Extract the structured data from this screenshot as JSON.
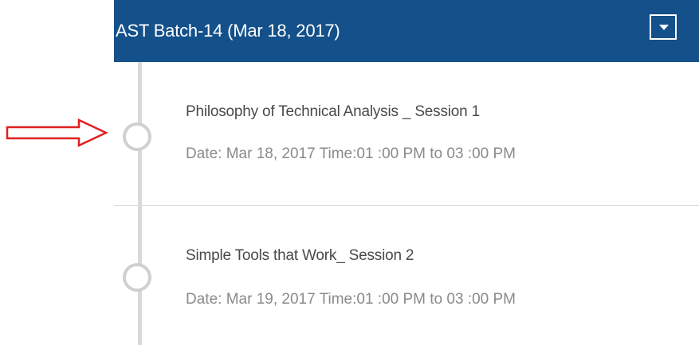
{
  "header": {
    "title": "AST Batch-14 (Mar 18, 2017)",
    "dropdown_icon": "caret-down-icon",
    "background_color": "#14508a"
  },
  "sessions": [
    {
      "title": "Philosophy of Technical Analysis _ Session 1",
      "datetime": "Date: Mar 18, 2017 Time:01 :00 PM to 03 :00 PM"
    },
    {
      "title": "Simple Tools that Work_ Session 2",
      "datetime": "Date: Mar 19, 2017 Time:01 :00 PM to 03 :00 PM"
    }
  ],
  "annotation": {
    "icon": "red-arrow-right-icon",
    "color": "#e02020"
  }
}
